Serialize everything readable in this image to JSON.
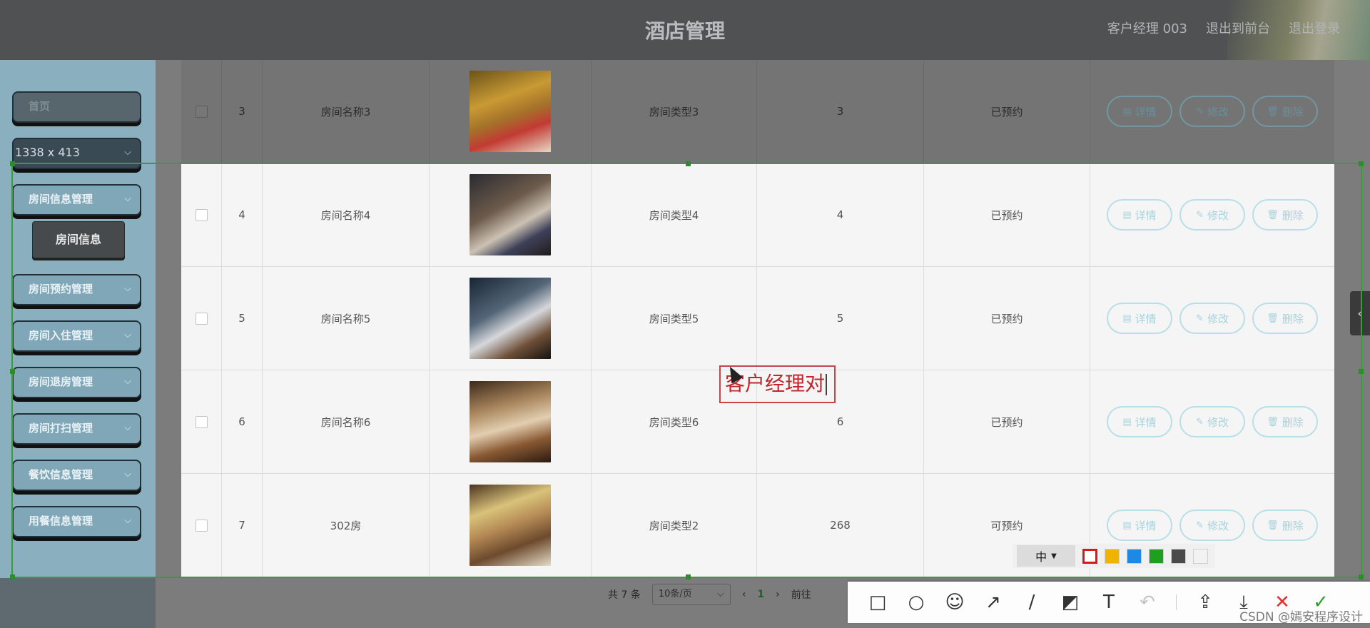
{
  "header": {
    "title": "酒店管理",
    "nav": [
      "客户经理 003",
      "退出到前台",
      "退出登录"
    ]
  },
  "sidebar": {
    "home": "首页",
    "size_indicator": "1338 x 413",
    "groups": [
      {
        "label": "房间信息管理",
        "expanded": true,
        "subitems": [
          "房间信息"
        ]
      },
      {
        "label": "房间预约管理"
      },
      {
        "label": "房间入住管理"
      },
      {
        "label": "房间退房管理"
      },
      {
        "label": "房间打扫管理"
      },
      {
        "label": "餐饮信息管理"
      },
      {
        "label": "用餐信息管理"
      }
    ]
  },
  "table": {
    "rows": [
      {
        "index": "3",
        "name": "房间名称3",
        "type": "房间类型3",
        "count": "3",
        "status": "已预约",
        "thumb": "r3"
      },
      {
        "index": "4",
        "name": "房间名称4",
        "type": "房间类型4",
        "count": "4",
        "status": "已预约",
        "thumb": "r4"
      },
      {
        "index": "5",
        "name": "房间名称5",
        "type": "房间类型5",
        "count": "5",
        "status": "已预约",
        "thumb": "r5"
      },
      {
        "index": "6",
        "name": "房间名称6",
        "type": "房间类型6",
        "count": "6",
        "status": "已预约",
        "thumb": "r6"
      },
      {
        "index": "7",
        "name": "302房",
        "type": "房间类型2",
        "count": "268",
        "status": "可预约",
        "thumb": "r7"
      }
    ],
    "actions": {
      "detail": "详情",
      "edit": "修改",
      "delete": "删除"
    }
  },
  "pagination": {
    "total": "共 7 条",
    "page_size": "10条/页",
    "current_page": "1",
    "goto_prefix": "前往"
  },
  "annotation": {
    "text": "客户经理对"
  },
  "capture_palette": {
    "font_size": "中",
    "colors": [
      "#ffffff",
      "#f0b400",
      "#1e88e5",
      "#1ea01e",
      "#4a4a4a",
      "#f2f2f2"
    ],
    "selected_color": "#d41a1a"
  },
  "toolbar": {
    "tools": [
      "rectangle-icon",
      "ellipse-icon",
      "emoji-icon",
      "arrow-icon",
      "pen-icon",
      "mosaic-icon",
      "text-icon",
      "undo-icon",
      "share-icon",
      "download-icon",
      "cancel-icon",
      "confirm-icon"
    ]
  },
  "watermark": "CSDN @嫣安程序设计"
}
